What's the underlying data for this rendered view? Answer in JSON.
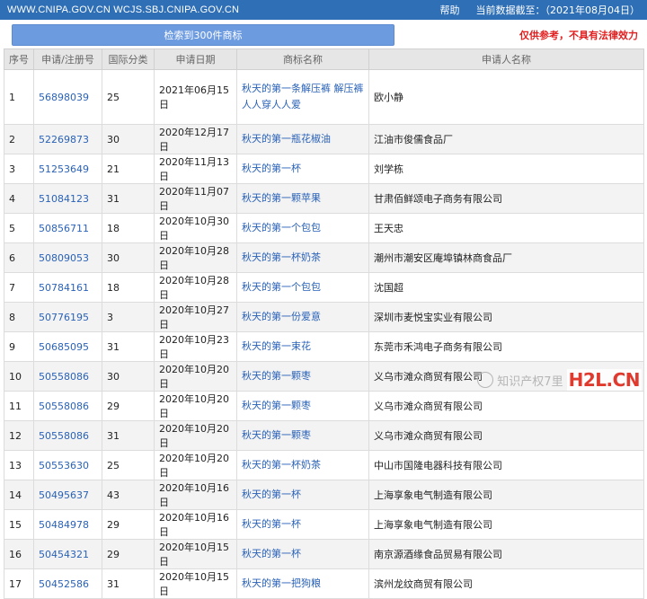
{
  "header": {
    "site": "WWW.CNIPA.GOV.CN WCJS.SBJ.CNIPA.GOV.CN",
    "help": "帮助",
    "data_date": "当前数据截至：（2021年08月04日）"
  },
  "actions": {
    "result_button": "检索到300件商标",
    "notice": "仅供参考，不具有法律效力"
  },
  "table": {
    "columns": [
      "序号",
      "申请/注册号",
      "国际分类",
      "申请日期",
      "商标名称",
      "申请人名称"
    ],
    "rows": [
      [
        "1",
        "56898039",
        "25",
        "2021年06月15日",
        "秋天的第一条解压裤 解压裤人人穿人人爱",
        "欧小静"
      ],
      [
        "2",
        "52269873",
        "30",
        "2020年12月17日",
        "秋天的第一瓶花椒油",
        "江油市俊儒食品厂"
      ],
      [
        "3",
        "51253649",
        "21",
        "2020年11月13日",
        "秋天的第一杯",
        "刘学栋"
      ],
      [
        "4",
        "51084123",
        "31",
        "2020年11月07日",
        "秋天的第一颗苹果",
        "甘肃佰鲜颂电子商务有限公司"
      ],
      [
        "5",
        "50856711",
        "18",
        "2020年10月30日",
        "秋天的第一个包包",
        "王天忠"
      ],
      [
        "6",
        "50809053",
        "30",
        "2020年10月28日",
        "秋天的第一杯奶茶",
        "潮州市潮安区庵埠镇林商食品厂"
      ],
      [
        "7",
        "50784161",
        "18",
        "2020年10月28日",
        "秋天的第一个包包",
        "沈国超"
      ],
      [
        "8",
        "50776195",
        "3",
        "2020年10月27日",
        "秋天的第一份爱意",
        "深圳市麦悦宝实业有限公司"
      ],
      [
        "9",
        "50685095",
        "31",
        "2020年10月23日",
        "秋天的第一束花",
        "东莞市禾鸿电子商务有限公司"
      ],
      [
        "10",
        "50558086",
        "30",
        "2020年10月20日",
        "秋天的第一颗枣",
        "义乌市滩众商贸有限公司"
      ],
      [
        "11",
        "50558086",
        "29",
        "2020年10月20日",
        "秋天的第一颗枣",
        "义乌市滩众商贸有限公司"
      ],
      [
        "12",
        "50558086",
        "31",
        "2020年10月20日",
        "秋天的第一颗枣",
        "义乌市滩众商贸有限公司"
      ],
      [
        "13",
        "50553630",
        "25",
        "2020年10月20日",
        "秋天的第一杯奶茶",
        "中山市国隆电器科技有限公司"
      ],
      [
        "14",
        "50495637",
        "43",
        "2020年10月16日",
        "秋天的第一杯",
        "上海享象电气制造有限公司"
      ],
      [
        "15",
        "50484978",
        "29",
        "2020年10月16日",
        "秋天的第一杯",
        "上海享象电气制造有限公司"
      ],
      [
        "16",
        "50454321",
        "29",
        "2020年10月15日",
        "秋天的第一杯",
        "南京源酒缘食品贸易有限公司"
      ],
      [
        "17",
        "50452586",
        "31",
        "2020年10月15日",
        "秋天的第一把狗粮",
        "滨州龙纹商贸有限公司"
      ]
    ]
  },
  "watermark": {
    "text": "知识产权7里",
    "logo": "H2L.CN"
  },
  "colors": {
    "header_bg": "#2f6fb6",
    "button_bg": "#6d9be0",
    "link": "#2a62b8",
    "notice": "#e02020"
  }
}
